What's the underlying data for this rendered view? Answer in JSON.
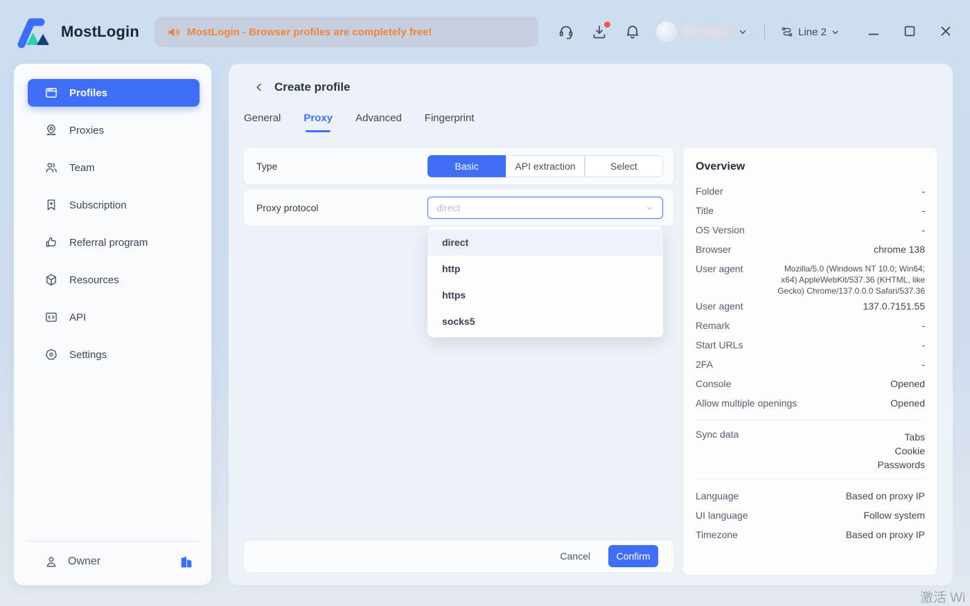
{
  "colors": {
    "primary_blue": "#3e6ff5",
    "announce_orange": "#ee8540",
    "badge_red": "#f5564e",
    "page_top": "#cdddf2",
    "page_bottom": "#e2e8ee"
  },
  "header": {
    "brand": "MostLogin",
    "announcement": "MostLogin - Browser profiles are completely free!",
    "line_selector": {
      "label": "Line 2"
    }
  },
  "sidebar": {
    "items": [
      {
        "icon": "browser-window-icon",
        "label": "Profiles",
        "active": true
      },
      {
        "icon": "location-pin-icon",
        "label": "Proxies"
      },
      {
        "icon": "users-icon",
        "label": "Team"
      },
      {
        "icon": "bookmark-plus-icon",
        "label": "Subscription"
      },
      {
        "icon": "thumbs-up-icon",
        "label": "Referral program"
      },
      {
        "icon": "package-icon",
        "label": "Resources"
      },
      {
        "icon": "code-window-icon",
        "label": "API"
      },
      {
        "icon": "settings-icon",
        "label": "Settings"
      }
    ],
    "owner": {
      "label": "Owner"
    }
  },
  "main": {
    "title": "Create profile",
    "tabs": [
      {
        "label": "General"
      },
      {
        "label": "Proxy",
        "active": true
      },
      {
        "label": "Advanced"
      },
      {
        "label": "Fingerprint"
      }
    ],
    "type_row": {
      "label": "Type",
      "options": [
        {
          "label": "Basic",
          "active": true
        },
        {
          "label": "API extraction"
        },
        {
          "label": "Select"
        }
      ]
    },
    "proxy_row": {
      "label": "Proxy protocol",
      "placeholder": "direct",
      "dropdown_options": [
        {
          "label": "direct",
          "highlighted": true
        },
        {
          "label": "http"
        },
        {
          "label": "https"
        },
        {
          "label": "socks5"
        }
      ]
    },
    "footer": {
      "cancel": "Cancel",
      "confirm": "Confirm"
    }
  },
  "overview": {
    "title": "Overview",
    "rows": [
      {
        "label": "Folder",
        "value": "-"
      },
      {
        "label": "Title",
        "value": "-"
      },
      {
        "label": "OS Version",
        "value": "-"
      },
      {
        "label": "Browser",
        "value": "chrome  138"
      },
      {
        "label": "User agent",
        "value": "Mozilla/5.0 (Windows NT 10.0; Win64; x64) AppleWebKit/537.36 (KHTML, like Gecko) Chrome/137.0.0.0 Safari/537.36"
      },
      {
        "label": "User agent",
        "value": "137.0.7151.55"
      },
      {
        "label": "Remark",
        "value": "-"
      },
      {
        "label": "Start URLs",
        "value": "-"
      },
      {
        "label": "2FA",
        "value": "-"
      },
      {
        "label": "Console",
        "value": "Opened"
      },
      {
        "label": "Allow multiple openings",
        "value": "Opened"
      }
    ],
    "sync": {
      "label": "Sync data",
      "value": "Tabs\nCookie\nPasswords"
    },
    "locale_rows": [
      {
        "label": "Language",
        "value": "Based on proxy IP"
      },
      {
        "label": "UI language",
        "value": "Follow system"
      },
      {
        "label": "Timezone",
        "value": "Based on proxy IP"
      }
    ]
  },
  "watermark": "激活 Wi"
}
